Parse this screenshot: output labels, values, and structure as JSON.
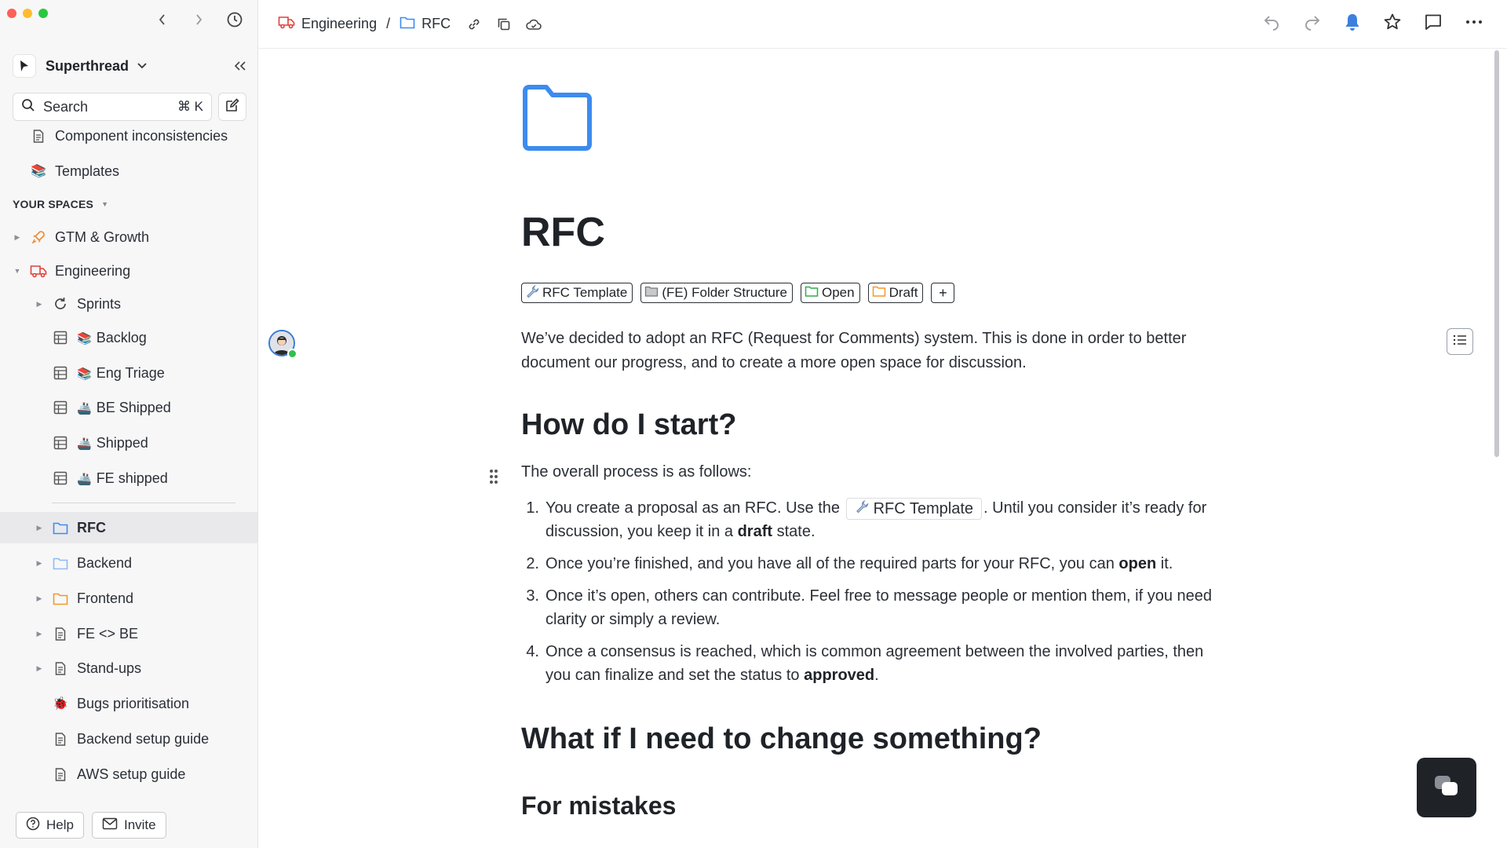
{
  "sidebar": {
    "workspace_name": "Superthread",
    "search_label": "Search",
    "search_shortcut": "⌘ K",
    "pinned": [
      {
        "label": "Component inconsistencies",
        "icon": "document-icon"
      },
      {
        "label": "Templates",
        "icon": "books-emoji"
      }
    ],
    "spaces_label": "YOUR SPACES",
    "spaces": [
      {
        "label": "GTM & Growth",
        "icon": "rocket-icon"
      },
      {
        "label": "Engineering",
        "icon": "truck-icon"
      }
    ],
    "engineering_children": [
      {
        "label": "Sprints",
        "icon": "refresh-icon"
      },
      {
        "label": "Backlog",
        "emoji": "📚"
      },
      {
        "label": "Eng Triage",
        "emoji": "📚"
      },
      {
        "label": "BE Shipped",
        "emoji": "🚢"
      },
      {
        "label": "Shipped",
        "emoji": "🚢"
      },
      {
        "label": "FE shipped",
        "emoji": "🚢"
      }
    ],
    "folders": [
      {
        "label": "RFC",
        "active": true
      },
      {
        "label": "Backend"
      },
      {
        "label": "Frontend"
      },
      {
        "label": "FE <> BE"
      },
      {
        "label": "Stand-ups"
      },
      {
        "label": "Bugs prioritisation",
        "emoji": "🐞"
      },
      {
        "label": "Backend setup guide"
      },
      {
        "label": "AWS setup guide"
      }
    ],
    "help_label": "Help",
    "invite_label": "Invite"
  },
  "topbar": {
    "breadcrumb": [
      "Engineering",
      "RFC"
    ],
    "separator": "/"
  },
  "doc": {
    "title": "RFC",
    "tags": [
      "RFC Template",
      "(FE) Folder Structure",
      "Open",
      "Draft"
    ],
    "add_tag": "+",
    "intro_paragraph": "We’ve decided to adopt an RFC (Request for Comments) system. This is done in order to better document our progress, and to create a more open space for discussion.",
    "heading_1": "How do I start?",
    "process_intro": "The overall process is as follows:",
    "steps": {
      "s1_num": "1.",
      "s1_a": "You create a proposal as an RFC. Use the",
      "s1_chip": "RFC Template",
      "s1_b": ". Until you consider it’s ready for discussion, you keep it in a",
      "s1_bold": "draft",
      "s1_c": "state.",
      "s2_num": "2.",
      "s2_a": "Once you’re finished, and you have all of the required parts for your RFC, you can",
      "s2_bold": "open",
      "s2_b": "it.",
      "s3_num": "3.",
      "s3_a": "Once it’s open, others can contribute. Feel free to message people or mention them, if you need clarity or simply a review.",
      "s4_num": "4.",
      "s4_a": "Once a consensus is reached, which is common agreement between the involved parties, then you can finalize and set the status to",
      "s4_bold": "approved",
      "s4_b": "."
    },
    "heading_2": "What if I need to change something?",
    "heading_3": "For mistakes"
  }
}
